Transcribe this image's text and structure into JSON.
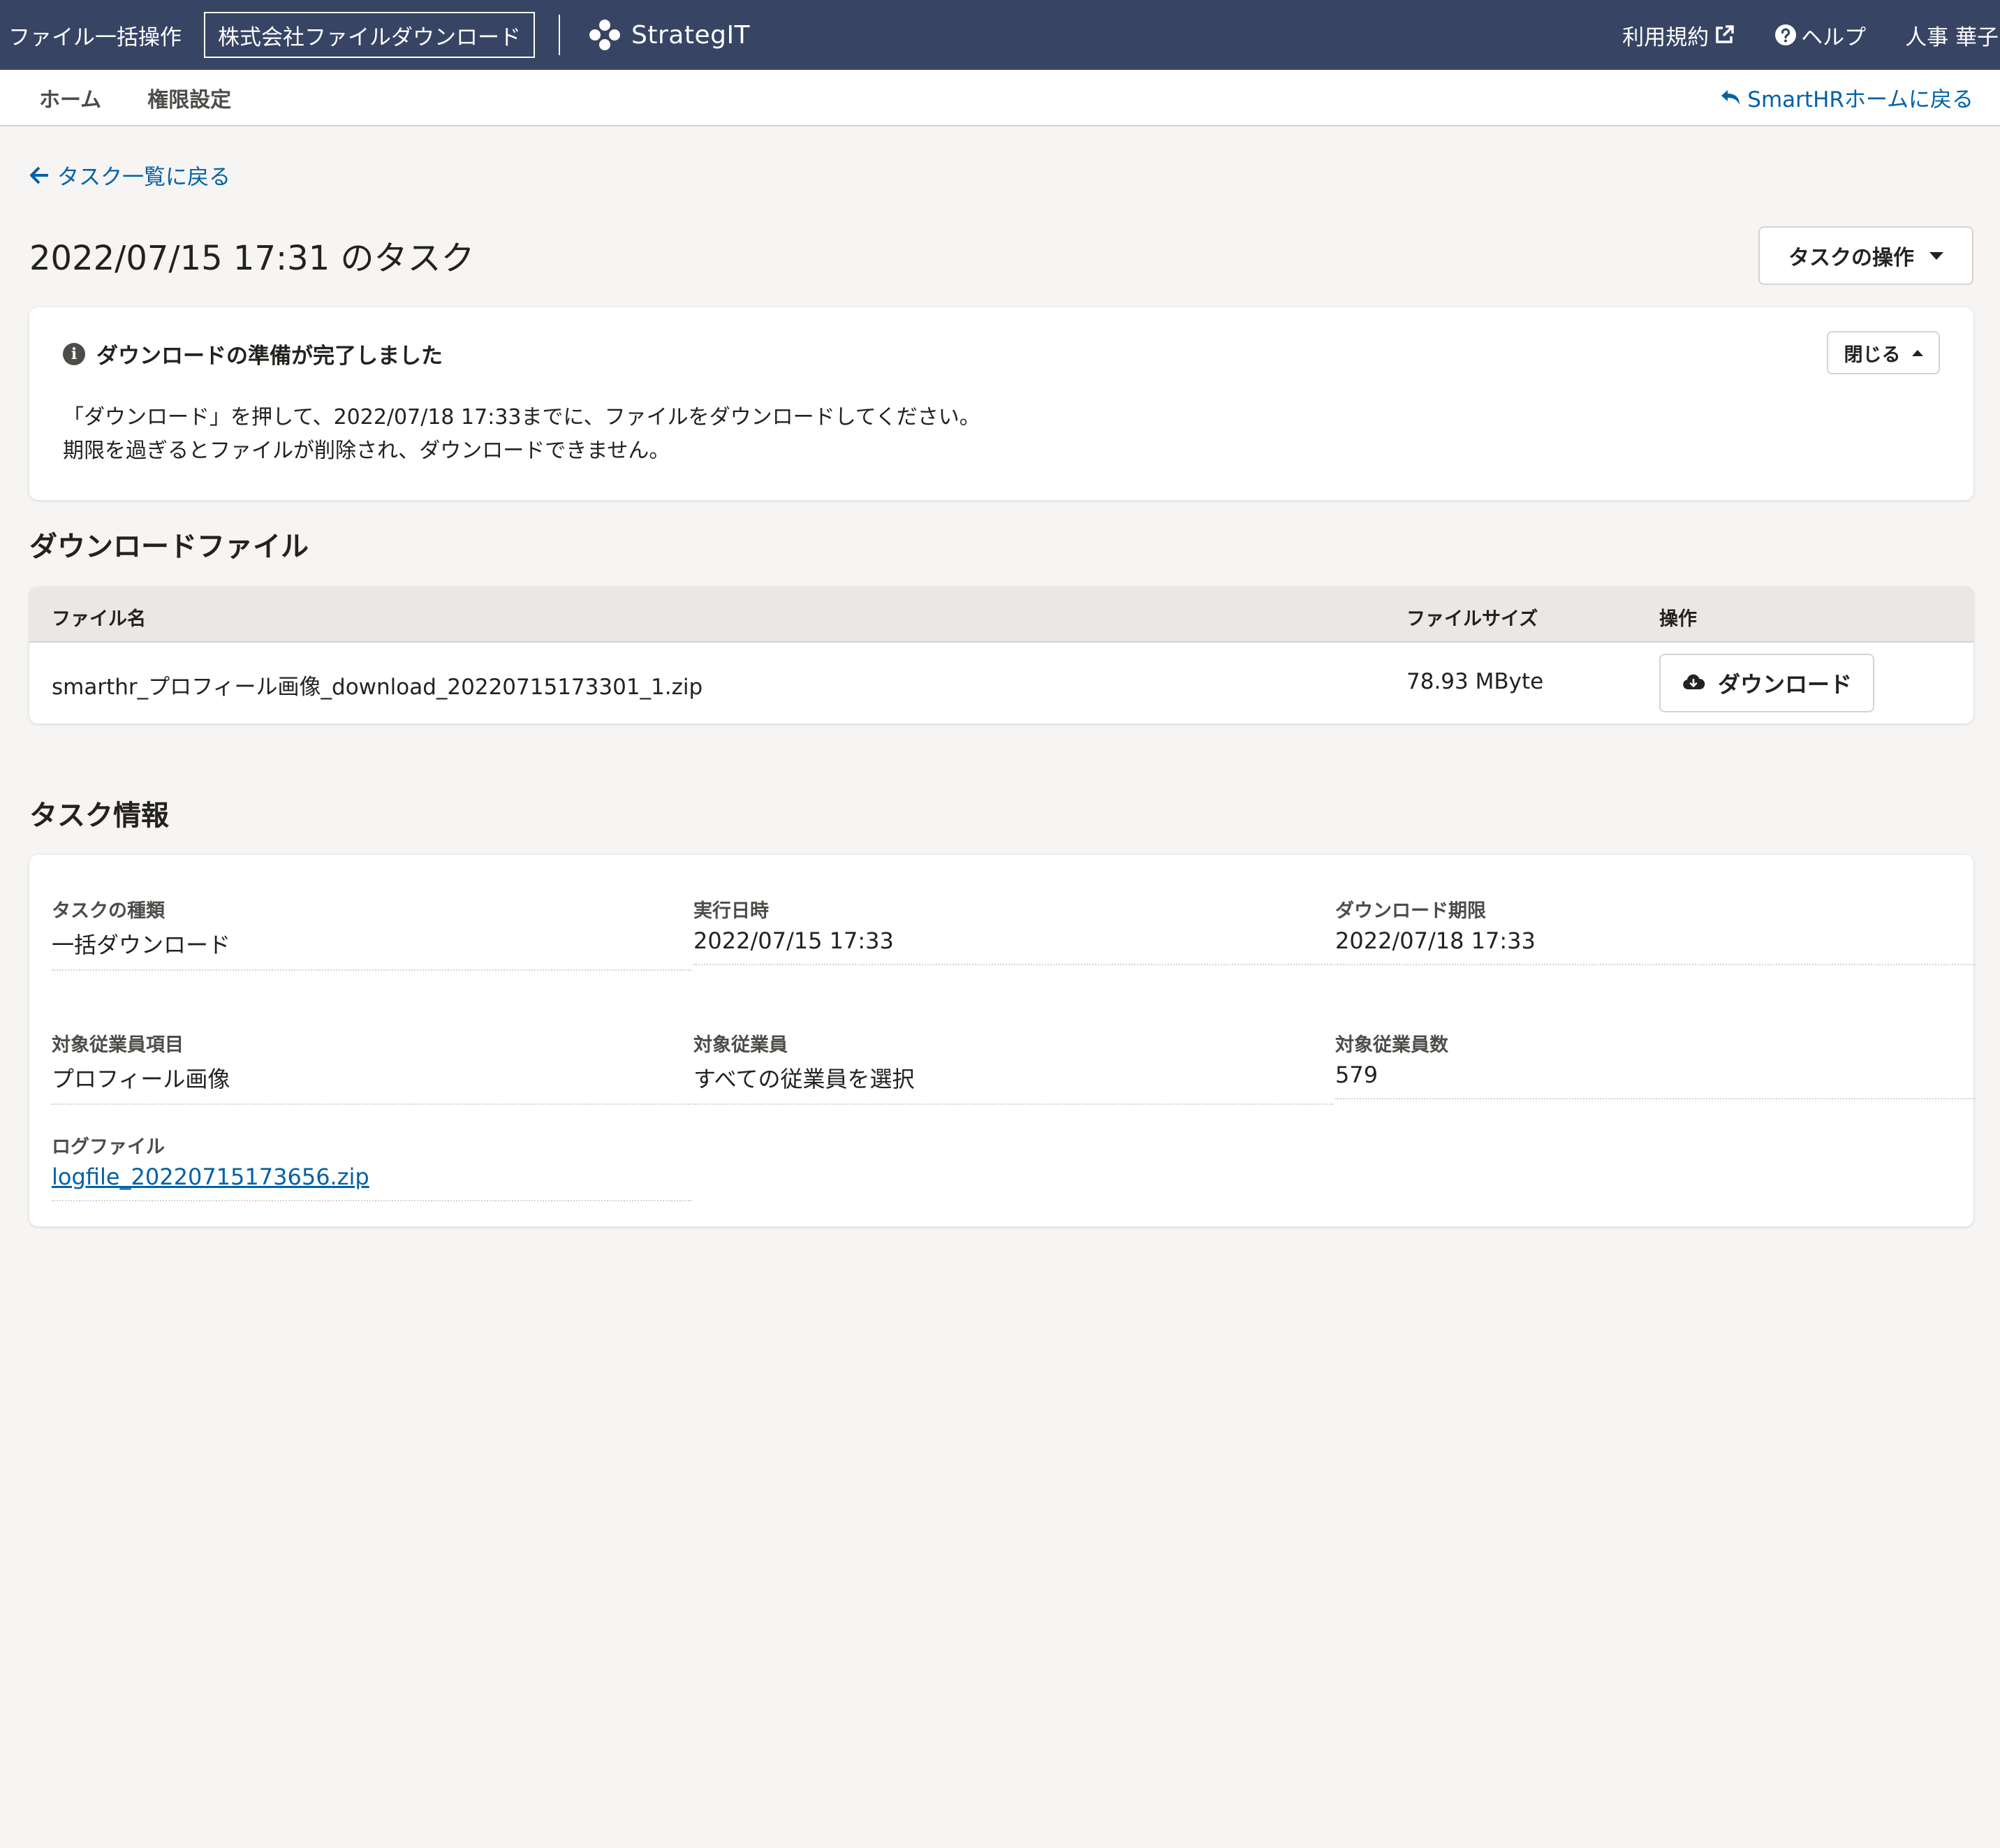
{
  "header": {
    "app_name": "ファイル一括操作",
    "tenant": "株式会社ファイルダウンロード",
    "brand": "StrategIT",
    "terms": "利用規約",
    "help": "ヘルプ",
    "user": "人事 華子"
  },
  "subnav": {
    "home": "ホーム",
    "permissions": "権限設定",
    "back_home": "SmartHRホームに戻る"
  },
  "page": {
    "back_link": "タスク一覧に戻る",
    "title": "2022/07/15 17:31 のタスク",
    "task_ops": "タスクの操作"
  },
  "notice": {
    "title": "ダウンロードの準備が完了しました",
    "close": "閉じる",
    "line1": "「ダウンロード」を押して、2022/07/18 17:33までに、ファイルをダウンロードしてください。",
    "line2": "期限を過ぎるとファイルが削除され、ダウンロードできません。"
  },
  "download_section": {
    "title": "ダウンロードファイル",
    "columns": {
      "name": "ファイル名",
      "size": "ファイルサイズ",
      "action": "操作"
    },
    "rows": [
      {
        "name": "smarthr_プロフィール画像_download_20220715173301_1.zip",
        "size": "78.93 MByte",
        "action": "ダウンロード"
      }
    ]
  },
  "task_info": {
    "title": "タスク情報",
    "fields": [
      {
        "label": "タスクの種類",
        "value": "一括ダウンロード"
      },
      {
        "label": "実行日時",
        "value": "2022/07/15 17:33"
      },
      {
        "label": "ダウンロード期限",
        "value": "2022/07/18 17:33"
      },
      {
        "label": "対象従業員項目",
        "value": "プロフィール画像"
      },
      {
        "label": "対象従業員",
        "value": "すべての従業員を選択"
      },
      {
        "label": "対象従業員数",
        "value": "579"
      },
      {
        "label": "ログファイル",
        "value": "logfile_20220715173656.zip"
      }
    ]
  },
  "colors": {
    "header_bg": "#384464",
    "link": "#0161a7",
    "page_bg": "#f6f5f3"
  }
}
